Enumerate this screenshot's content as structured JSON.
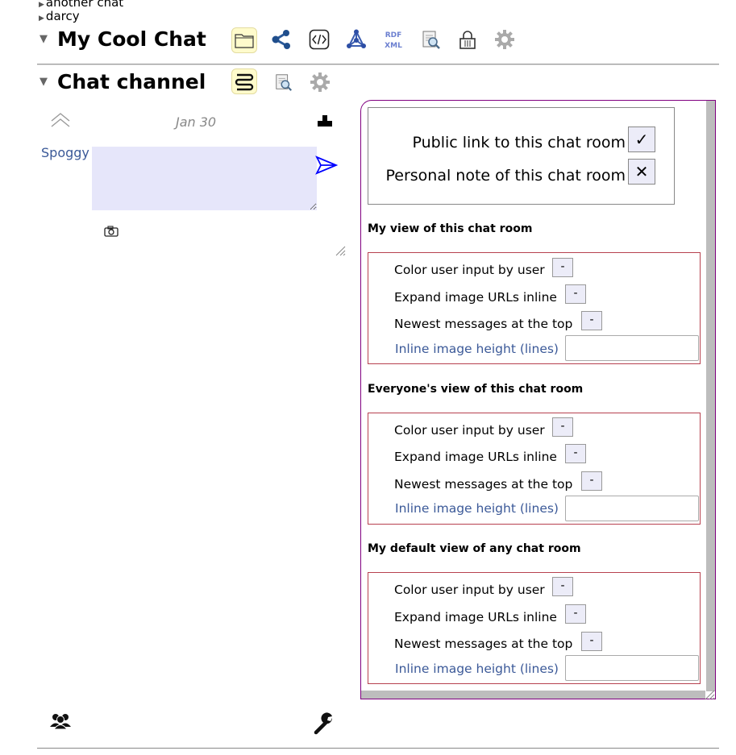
{
  "tree": {
    "items": [
      "another chat",
      "darcy"
    ]
  },
  "app": {
    "title": "My Cool Chat"
  },
  "channel": {
    "title": "Chat channel"
  },
  "chat": {
    "date": "Jan 30",
    "user": "Spoggy",
    "message_value": ""
  },
  "public_box": {
    "public_link_label": "Public link to this chat room",
    "public_link_mark": "✓",
    "personal_note_label": "Personal note of this chat room",
    "personal_note_mark": "✕"
  },
  "sections": [
    {
      "title": "My view of this chat room",
      "color_label": "Color user input by user",
      "expand_label": "Expand image URLs inline",
      "newest_label": "Newest messages at the top",
      "height_label": "Inline image height (lines)",
      "toggle": "-",
      "height_value": ""
    },
    {
      "title": "Everyone's view of this chat room",
      "color_label": "Color user input by user",
      "expand_label": "Expand image URLs inline",
      "newest_label": "Newest messages at the top",
      "height_label": "Inline image height (lines)",
      "toggle": "-",
      "height_value": ""
    },
    {
      "title": "My default view of any chat room",
      "color_label": "Color user input by user",
      "expand_label": "Expand image URLs inline",
      "newest_label": "Newest messages at the top",
      "height_label": "Inline image height (lines)",
      "toggle": "-",
      "height_value": ""
    }
  ],
  "icons": {
    "toolbar": [
      "folder-icon",
      "share-network-icon",
      "code-icon",
      "graph-icon",
      "rdf-xml-icon",
      "search-document-icon",
      "lock-icon",
      "gear-icon"
    ],
    "channel_toolbar": [
      "chat-list-icon",
      "search-document-icon",
      "gear-icon"
    ],
    "footer": [
      "people-icon",
      "wrench-icon"
    ]
  },
  "colors": {
    "accent": "#3b5998",
    "panel_border": "#800080",
    "box_border": "#b7414f",
    "input_bg": "#e6e6fa",
    "send": "#0000ff"
  }
}
